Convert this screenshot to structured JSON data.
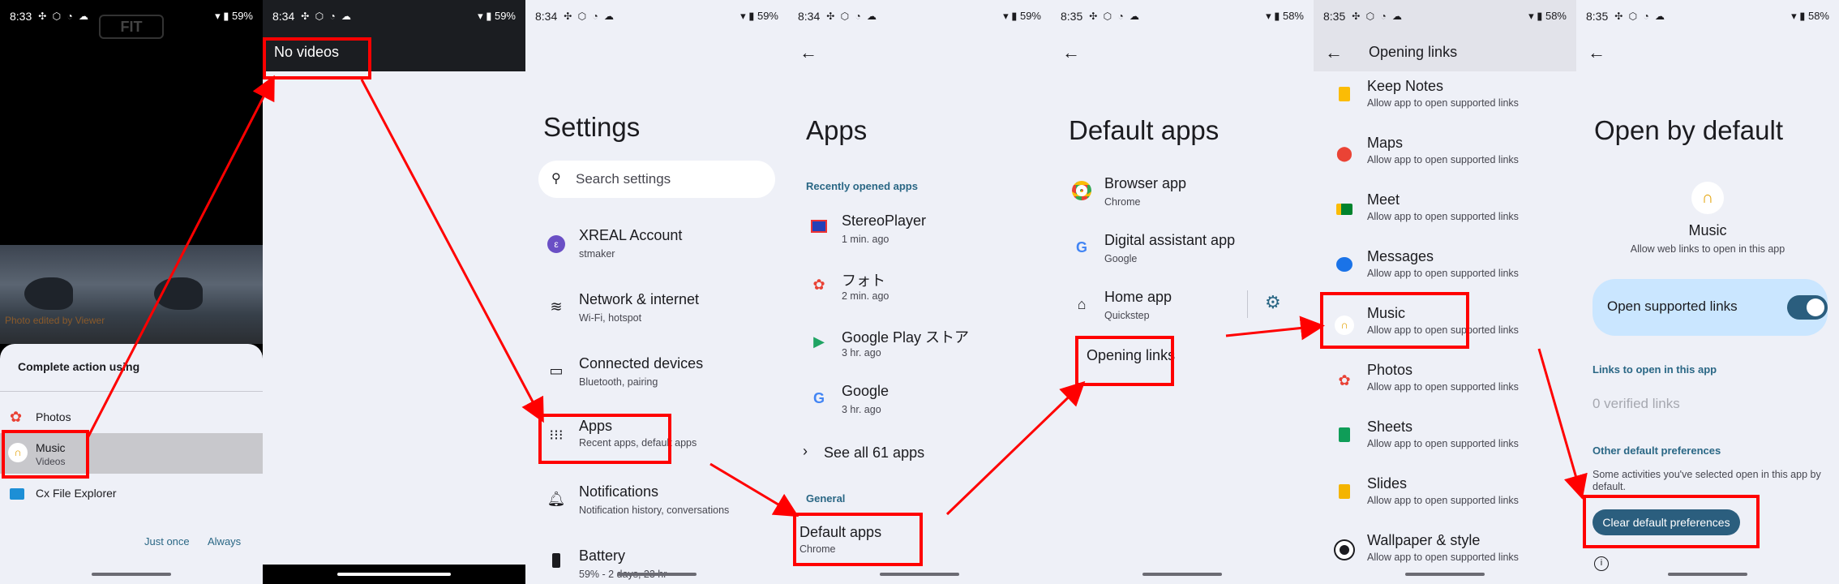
{
  "panel1": {
    "status_time": "8:33",
    "status_battery": "59%",
    "fit_label": "FIT",
    "video_caption": "Photo edited by Viewer",
    "sheet_title": "Complete action using",
    "options": [
      {
        "label": "Photos",
        "sub": ""
      },
      {
        "label": "Music",
        "sub": "Videos"
      },
      {
        "label": "Cx File Explorer",
        "sub": ""
      }
    ],
    "just_once": "Just once",
    "always": "Always"
  },
  "panel2": {
    "status_time": "8:34",
    "status_battery": "59%",
    "header_text": "No videos"
  },
  "panel3": {
    "status_time": "8:34",
    "status_battery": "59%",
    "title": "Settings",
    "search_placeholder": "Search settings",
    "items": [
      {
        "label": "XREAL Account",
        "sub": "stmaker"
      },
      {
        "label": "Network & internet",
        "sub": "Wi-Fi, hotspot"
      },
      {
        "label": "Connected devices",
        "sub": "Bluetooth, pairing"
      },
      {
        "label": "Apps",
        "sub": "Recent apps, default apps"
      },
      {
        "label": "Notifications",
        "sub": "Notification history, conversations"
      },
      {
        "label": "Battery",
        "sub": "59% - 2 days, 23 hr"
      }
    ]
  },
  "panel4": {
    "status_time": "8:34",
    "status_battery": "59%",
    "title": "Apps",
    "recent_header": "Recently opened apps",
    "recent": [
      {
        "label": "StereoPlayer",
        "sub": "1 min. ago"
      },
      {
        "label": "フォト",
        "sub": "2 min. ago"
      },
      {
        "label": "Google Play ストア",
        "sub": "3 hr. ago"
      },
      {
        "label": "Google",
        "sub": "3 hr. ago"
      }
    ],
    "see_all": "See all 61 apps",
    "general_header": "General",
    "default_apps_label": "Default apps",
    "default_apps_sub": "Chrome"
  },
  "panel5": {
    "status_time": "8:35",
    "status_battery": "58%",
    "title": "Default apps",
    "items": [
      {
        "label": "Browser app",
        "sub": "Chrome"
      },
      {
        "label": "Digital assistant app",
        "sub": "Google"
      },
      {
        "label": "Home app",
        "sub": "Quickstep"
      }
    ],
    "opening_links": "Opening links"
  },
  "panel6": {
    "status_time": "8:35",
    "status_battery": "58%",
    "title": "Opening links",
    "sub_text": "Allow app to open supported links",
    "apps": [
      "Keep Notes",
      "Maps",
      "Meet",
      "Messages",
      "Music",
      "Photos",
      "Sheets",
      "Slides",
      "Wallpaper & style"
    ]
  },
  "panel7": {
    "status_time": "8:35",
    "status_battery": "58%",
    "title": "Open by default",
    "app_name": "Music",
    "app_desc": "Allow web links to open in this app",
    "toggle_label": "Open supported links",
    "links_header": "Links to open in this app",
    "verified": "0 verified links",
    "other_header": "Other default preferences",
    "other_desc": "Some activities you've selected open in this app by default.",
    "clear_button": "Clear default preferences"
  },
  "colors": {
    "accent": "#2a6785",
    "highlight": "#ff0000",
    "toggle": "#2b5e7e"
  }
}
